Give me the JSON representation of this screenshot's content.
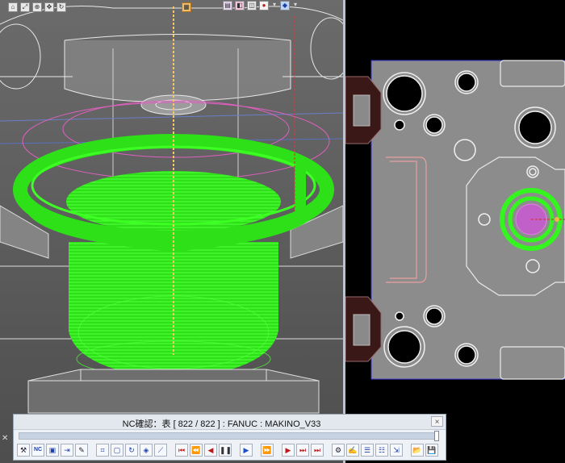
{
  "window": {
    "close_symbol": "✕"
  },
  "nc_panel": {
    "title": "NC確認：表 [ 822 / 822 ] : FANUC : MAKINO_V33",
    "close_symbol": "×",
    "progress": {
      "current": 822,
      "total": 822
    },
    "buttons": [
      {
        "name": "tools-icon",
        "glyph": "⚒",
        "style": ""
      },
      {
        "name": "nc-icon",
        "glyph": "NC",
        "style": "nc-text"
      },
      {
        "name": "image-view-icon",
        "glyph": "▣",
        "style": "blue"
      },
      {
        "name": "list-arrow-icon",
        "glyph": "⇥",
        "style": "blue"
      },
      {
        "name": "brush-icon",
        "glyph": "✎",
        "style": ""
      },
      {
        "name": "sep",
        "glyph": "",
        "style": "sep"
      },
      {
        "name": "frame-select-icon",
        "glyph": "⌗",
        "style": "blue"
      },
      {
        "name": "box-select-icon",
        "glyph": "▢",
        "style": "blue"
      },
      {
        "name": "rotate-view-icon",
        "glyph": "↻",
        "style": "blue"
      },
      {
        "name": "layer-icon",
        "glyph": "◈",
        "style": "blue"
      },
      {
        "name": "tool-path-icon",
        "glyph": "⟋",
        "style": "blue"
      },
      {
        "name": "sep",
        "glyph": "",
        "style": "sep"
      },
      {
        "name": "go-start-icon",
        "glyph": "⏮",
        "style": "rw"
      },
      {
        "name": "step-back-icon",
        "glyph": "⏪",
        "style": "rw"
      },
      {
        "name": "rewind-icon",
        "glyph": "◀",
        "style": "rw"
      },
      {
        "name": "pause-icon",
        "glyph": "❚❚",
        "style": "pause"
      },
      {
        "name": "sep",
        "glyph": "",
        "style": "sep"
      },
      {
        "name": "play-icon",
        "glyph": "▶",
        "style": "play"
      },
      {
        "name": "sep",
        "glyph": "",
        "style": "sep"
      },
      {
        "name": "fast-forward-icon",
        "glyph": "⏩",
        "style": "play"
      },
      {
        "name": "sep",
        "glyph": "",
        "style": "sep"
      },
      {
        "name": "step-forward-icon",
        "glyph": "▶",
        "style": "rw"
      },
      {
        "name": "next-icon",
        "glyph": "⏭",
        "style": "rw"
      },
      {
        "name": "go-end-icon",
        "glyph": "⏭",
        "style": "rw"
      },
      {
        "name": "sep",
        "glyph": "",
        "style": "sep"
      },
      {
        "name": "measure-icon",
        "glyph": "⚙",
        "style": ""
      },
      {
        "name": "edit-icon",
        "glyph": "✍",
        "style": "blue"
      },
      {
        "name": "list-icon",
        "glyph": "☰",
        "style": "blue"
      },
      {
        "name": "list-edit-icon",
        "glyph": "☷",
        "style": "blue"
      },
      {
        "name": "export-icon",
        "glyph": "⇲",
        "style": "blue"
      },
      {
        "name": "sep",
        "glyph": "",
        "style": "sep"
      },
      {
        "name": "open-folder-icon",
        "glyph": "📂",
        "style": ""
      },
      {
        "name": "save-icon",
        "glyph": "💾",
        "style": ""
      }
    ]
  },
  "top_toolbar": {
    "left_buttons": [
      "home-icon",
      "fit-view-icon",
      "zoom-icon",
      "pan-icon",
      "rotate-icon",
      "highlight-icon",
      "section-icon",
      "shade-icon",
      "wire-icon",
      "grid-icon"
    ],
    "right_buttons": [
      "layer-icon",
      "color-icon",
      "camera-icon",
      "flag-icon",
      "dropdown-icon",
      "cube-icon",
      "dropdown-icon"
    ]
  },
  "colors": {
    "toolpath": "#35f51f",
    "magenta": "#e060c0",
    "tool_axis": "#f5b547",
    "part_fill": "#8a8a8a",
    "background_3d": "#5c5c5c"
  }
}
